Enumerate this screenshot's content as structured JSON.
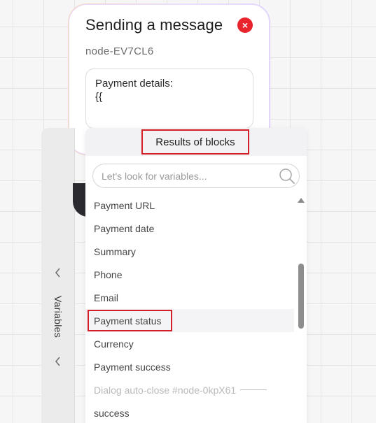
{
  "node": {
    "title": "Sending a message",
    "id": "node-EV7CL6",
    "message": "Payment details:\n{{",
    "close_icon": "×"
  },
  "variables_rail": {
    "label": "Variables"
  },
  "panel": {
    "title": "Results of blocks",
    "search_placeholder": "Let's look for variables...",
    "items": [
      "Payment URL",
      "Payment date",
      "Summary",
      "Phone",
      "Email",
      "Payment status",
      "Currency",
      "Payment success",
      "Dialog auto-close #node-0kpX61",
      "success"
    ],
    "highlighted_item": "Payment status"
  },
  "colors": {
    "close": "#e8242c",
    "highlight_border": "#d21f29"
  }
}
